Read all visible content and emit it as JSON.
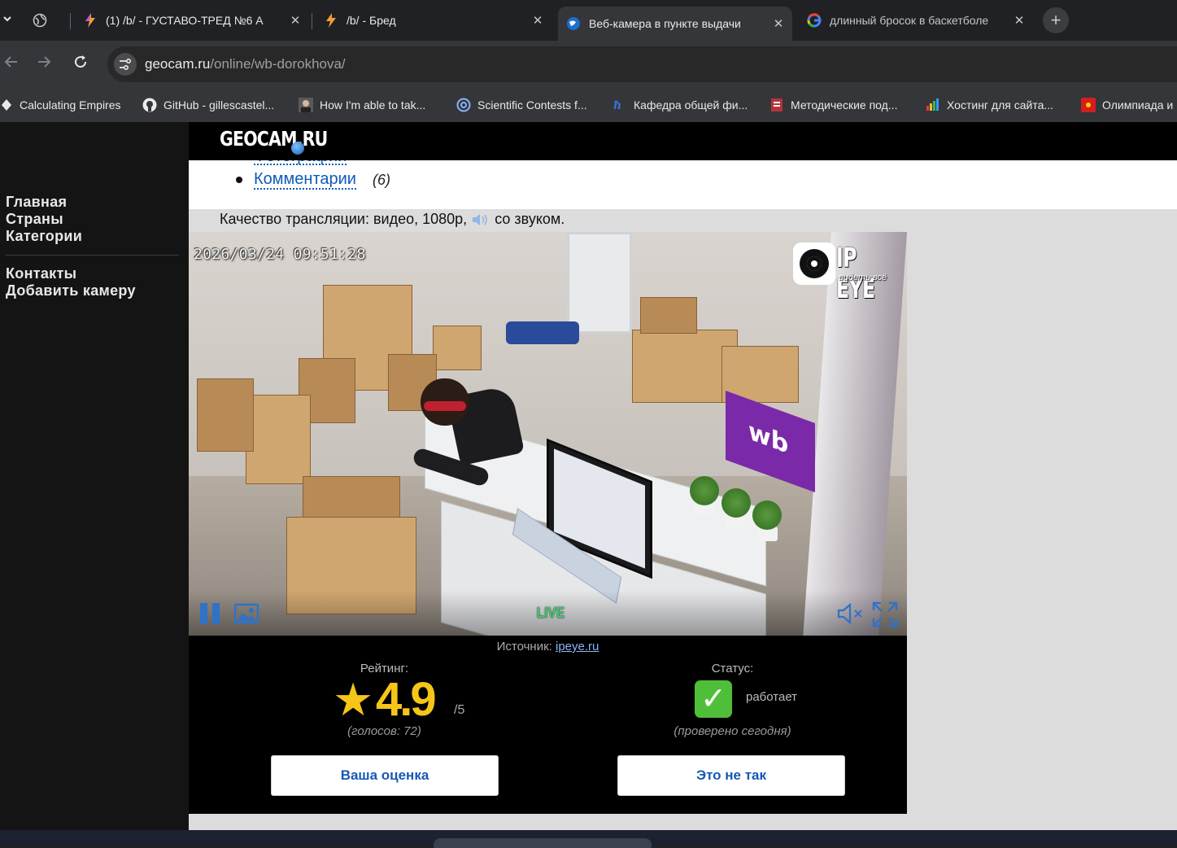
{
  "browser": {
    "tabs": [
      {
        "title": "",
        "icon": "globe-icon",
        "active": false
      },
      {
        "title": "(1) /b/ - ГУСТАВО-ТРЕД №6 А",
        "icon": "bolt-icon",
        "active": false
      },
      {
        "title": "/b/ - Бред",
        "icon": "bolt-icon",
        "active": false
      },
      {
        "title": "Веб-камера в пункте выдачи",
        "icon": "geocam-icon",
        "active": true
      },
      {
        "title": "длинный бросок в баскетболе",
        "icon": "google-icon",
        "active": false
      }
    ],
    "url_host": "geocam.ru",
    "url_path": "/online/wb-dorokhova/",
    "bookmarks": [
      "Calculating Empires",
      "GitHub - gillescastel...",
      "How I'm able to tak...",
      "Scientific Contests f...",
      "Кафедра общей фи...",
      "Методические под...",
      "Хостинг для сайта...",
      "Олимпиада и"
    ]
  },
  "site": {
    "logo": "GEOCAM.RU",
    "nav": {
      "home": "Главная",
      "countries": "Страны",
      "categories": "Категории",
      "contacts": "Контакты",
      "add_camera": "Добавить камеру"
    },
    "cut_link": "Фотографии",
    "comments_link": "Комментарии",
    "comments_count": "(6)",
    "quality_prefix": "Качество трансляции: видео, 1080р,",
    "quality_suffix": "со звуком."
  },
  "video": {
    "timestamp": "2026/03/24 09:51:28",
    "brand": "IP EYE",
    "slogan": "видеть всё",
    "live_label": "LIVE",
    "mat_text": "wb"
  },
  "info": {
    "source_label": "Источник:",
    "source_link": "ipeye.ru",
    "rating_label": "Рейтинг:",
    "rating_value": "4.9",
    "rating_max": "/5",
    "votes": "(голосов: 72)",
    "status_label": "Статус:",
    "status_value": "работает",
    "status_checked": "(проверено сегодня)",
    "rate_button": "Ваша оценка",
    "report_button": "Это не так"
  },
  "colors": {
    "accent": "#1659b3",
    "link": "#0d5bb8",
    "star": "#f5c518",
    "live": "#3fc76c",
    "status_ok": "#4fbf3a"
  }
}
